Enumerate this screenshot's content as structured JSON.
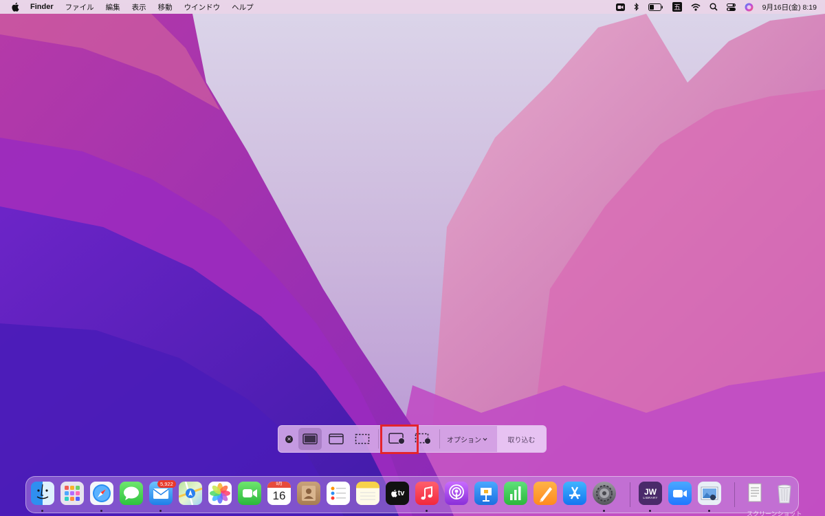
{
  "menubar": {
    "app_name": "Finder",
    "items": [
      "ファイル",
      "編集",
      "表示",
      "移動",
      "ウインドウ",
      "ヘルプ"
    ],
    "ime_label": "五",
    "clock": "9月16日(金)  8:19",
    "status_icons": [
      "camera-icon",
      "bluetooth-icon",
      "battery-icon",
      "input-method-icon",
      "wifi-icon",
      "search-icon",
      "control-center-icon",
      "siri-icon"
    ]
  },
  "capture_bar": {
    "tools": [
      "close-icon",
      "capture-entire-screen-icon",
      "capture-window-icon",
      "capture-selection-icon",
      "record-entire-screen-icon",
      "record-selection-icon"
    ],
    "selected_tool": "capture-entire-screen-icon",
    "highlighted_tool": "record-entire-screen-icon",
    "highlight_color": "#e4242c",
    "options_label": "オプション",
    "capture_label": "取り込む"
  },
  "dock": {
    "apps": [
      {
        "name": "Finder",
        "icon": "finder-icon",
        "running": true
      },
      {
        "name": "Launchpad",
        "icon": "launchpad-icon",
        "running": false
      },
      {
        "name": "Safari",
        "icon": "safari-icon",
        "running": true
      },
      {
        "name": "Messages",
        "icon": "messages-icon",
        "running": false
      },
      {
        "name": "Mail",
        "icon": "mail-icon",
        "running": true,
        "badge": "5,922"
      },
      {
        "name": "Maps",
        "icon": "maps-icon",
        "running": false
      },
      {
        "name": "Photos",
        "icon": "photos-icon",
        "running": false
      },
      {
        "name": "FaceTime",
        "icon": "facetime-icon",
        "running": false
      },
      {
        "name": "Calendar",
        "icon": "calendar-icon",
        "running": false,
        "month": "9月",
        "day": "16"
      },
      {
        "name": "Contacts",
        "icon": "contacts-icon",
        "running": false
      },
      {
        "name": "Reminders",
        "icon": "reminders-icon",
        "running": false
      },
      {
        "name": "Notes",
        "icon": "notes-icon",
        "running": false
      },
      {
        "name": "TV",
        "icon": "tv-icon",
        "running": false,
        "label": "tv"
      },
      {
        "name": "Music",
        "icon": "music-icon",
        "running": true
      },
      {
        "name": "Podcasts",
        "icon": "podcasts-icon",
        "running": false
      },
      {
        "name": "Keynote",
        "icon": "keynote-icon",
        "running": false
      },
      {
        "name": "Numbers",
        "icon": "numbers-icon",
        "running": false
      },
      {
        "name": "Pages",
        "icon": "pages-icon",
        "running": false
      },
      {
        "name": "App Store",
        "icon": "app-store-icon",
        "running": false
      },
      {
        "name": "System Preferences",
        "icon": "system-preferences-icon",
        "running": true
      },
      {
        "name": "JW Library",
        "icon": "jw-library-icon",
        "running": true,
        "label": "JW",
        "sublabel": "LIBRARY"
      },
      {
        "name": "Zoom",
        "icon": "zoom-icon",
        "running": false
      },
      {
        "name": "Preview",
        "icon": "preview-icon",
        "running": true
      },
      {
        "name": "Document",
        "icon": "document-stack-icon",
        "running": false
      },
      {
        "name": "Trash",
        "icon": "trash-icon",
        "running": false
      }
    ],
    "partial_label": "スクリーンショット"
  },
  "colors": {
    "wallpaper_top": "#d6d0e6",
    "wallpaper_pink": "#c24aa8",
    "wallpaper_purple": "#5a22c4",
    "menubar_bg": "#eed4e8"
  }
}
